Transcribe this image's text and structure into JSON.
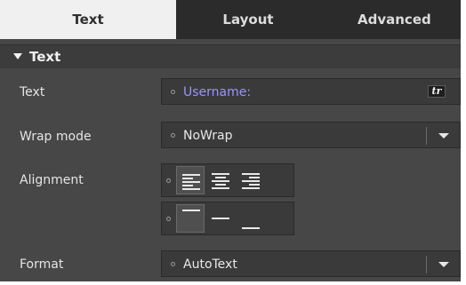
{
  "tabs": [
    {
      "label": "Text",
      "active": true
    },
    {
      "label": "Layout",
      "active": false
    },
    {
      "label": "Advanced",
      "active": false
    }
  ],
  "section": {
    "title": "Text",
    "expanded": true
  },
  "properties": {
    "text": {
      "label": "Text",
      "value": "Username:",
      "tr_label": "tr"
    },
    "wrap_mode": {
      "label": "Wrap mode",
      "value": "NoWrap"
    },
    "alignment": {
      "label": "Alignment",
      "horizontal_options": [
        "align-left",
        "align-center",
        "align-right"
      ],
      "horizontal_selected": "align-left",
      "vertical_options": [
        "align-top",
        "align-vcenter",
        "align-bottom"
      ],
      "vertical_selected": "align-top"
    },
    "format": {
      "label": "Format",
      "value": "AutoText"
    }
  },
  "colors": {
    "panel_bg": "#474747",
    "tab_bar_bg": "#2b2b2b",
    "active_tab_bg": "#f0f0f0",
    "field_bg": "#3a3a3a",
    "link_text": "#9b93ff",
    "label_text": "#e4e4e4"
  }
}
